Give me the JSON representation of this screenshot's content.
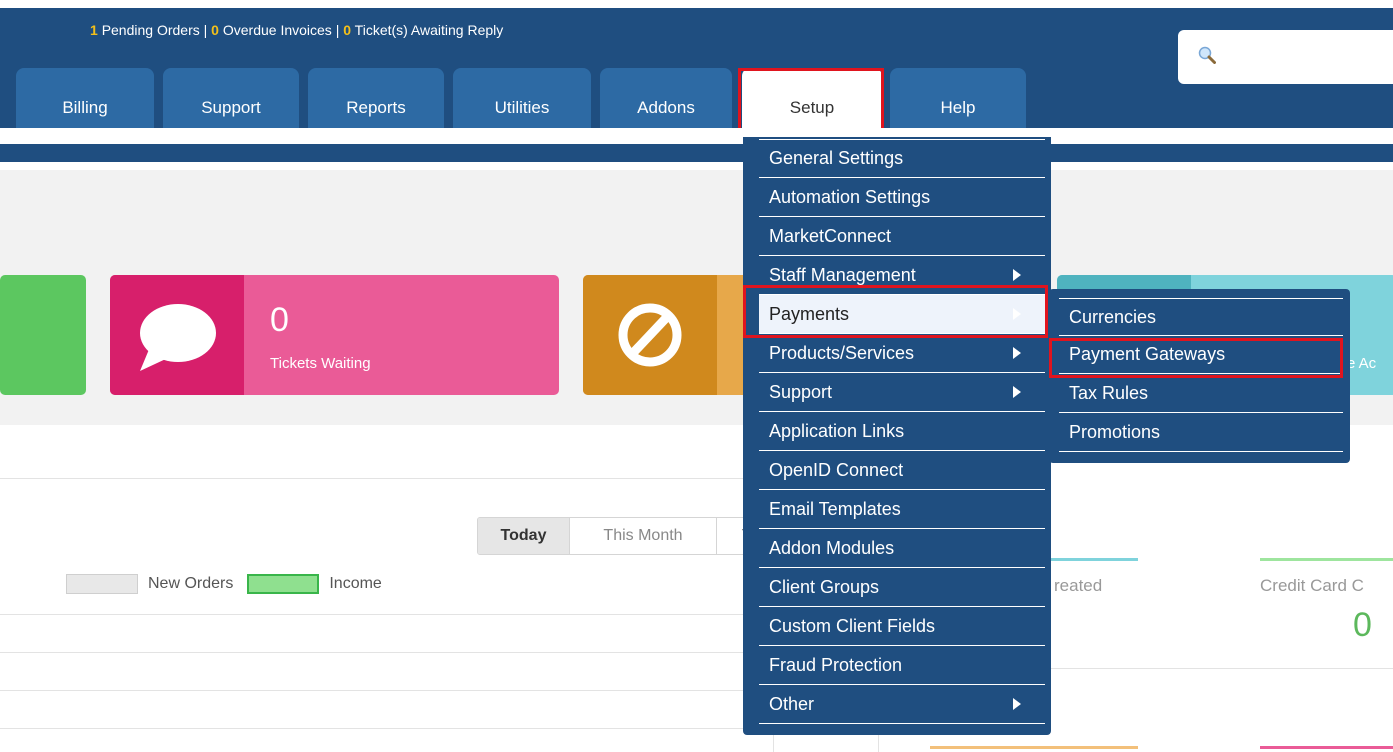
{
  "header": {
    "pending_orders_count": "1",
    "pending_orders_label": "Pending Orders",
    "overdue_invoices_count": "0",
    "overdue_invoices_label": "Overdue Invoices",
    "tickets_count": "0",
    "tickets_label": "Ticket(s) Awaiting Reply",
    "separator": "|",
    "search_icon": "magnifier-icon"
  },
  "nav": {
    "tabs": [
      {
        "label": "Billing"
      },
      {
        "label": "Support"
      },
      {
        "label": "Reports"
      },
      {
        "label": "Utilities"
      },
      {
        "label": "Addons"
      },
      {
        "label": "Setup",
        "active": true
      },
      {
        "label": "Help"
      }
    ]
  },
  "cards": {
    "tickets": {
      "value": "0",
      "label": "Tickets Waiting",
      "icon": "speech-bubble-icon"
    },
    "cancellations": {
      "icon": "prohibited-icon"
    },
    "teal": {
      "label_fragment": "e Ac"
    }
  },
  "chart_panel": {
    "periods": [
      "Today",
      "This Month",
      "T"
    ],
    "active_period": "Today",
    "legend": [
      "New Orders",
      "Income"
    ]
  },
  "stats": {
    "created_label": "reated",
    "credit_card_label": "Credit Card C",
    "credit_card_value": "0"
  },
  "setup_menu": {
    "items": [
      {
        "label": "General Settings",
        "submenu": false
      },
      {
        "label": "Automation Settings",
        "submenu": false
      },
      {
        "label": "MarketConnect",
        "submenu": false
      },
      {
        "label": "Staff Management",
        "submenu": true
      },
      {
        "label": "Payments",
        "submenu": true,
        "hovered": true
      },
      {
        "label": "Products/Services",
        "submenu": true
      },
      {
        "label": "Support",
        "submenu": true
      },
      {
        "label": "Application Links",
        "submenu": false
      },
      {
        "label": "OpenID Connect",
        "submenu": false
      },
      {
        "label": "Email Templates",
        "submenu": false
      },
      {
        "label": "Addon Modules",
        "submenu": false
      },
      {
        "label": "Client Groups",
        "submenu": false
      },
      {
        "label": "Custom Client Fields",
        "submenu": false
      },
      {
        "label": "Fraud Protection",
        "submenu": false
      },
      {
        "label": "Other",
        "submenu": true
      }
    ]
  },
  "payments_submenu": {
    "items": [
      {
        "label": "Currencies"
      },
      {
        "label": "Payment Gateways"
      },
      {
        "label": "Tax Rules"
      },
      {
        "label": "Promotions"
      }
    ]
  },
  "colors": {
    "header_blue": "#1f4e80",
    "tab_blue": "#2d6aa4",
    "highlight_red": "#e0141e",
    "pink": "#ea5b97",
    "orange": "#e7a84a",
    "teal": "#7fd3dc",
    "green": "#5cc760",
    "count_yellow": "#f3c01a"
  }
}
